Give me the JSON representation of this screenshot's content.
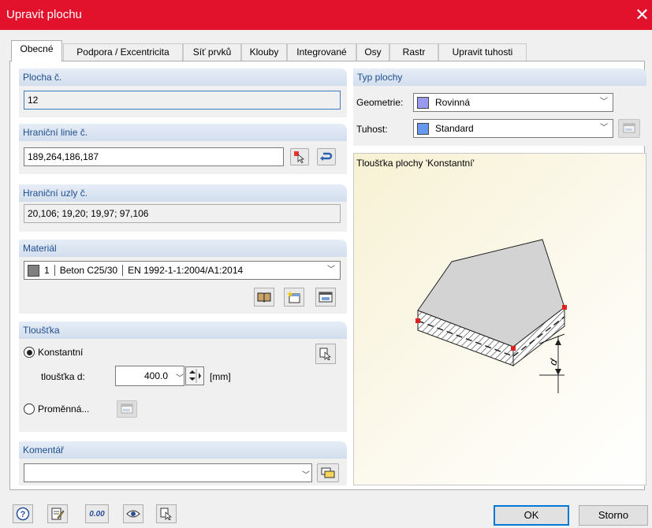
{
  "window": {
    "title": "Upravit plochu",
    "close_glyph": "✕"
  },
  "tabs": [
    {
      "label": "Obecné",
      "active": true
    },
    {
      "label": "Podpora / Excentricita"
    },
    {
      "label": "Síť prvků"
    },
    {
      "label": "Klouby"
    },
    {
      "label": "Integrované"
    },
    {
      "label": "Osy"
    },
    {
      "label": "Rastr"
    },
    {
      "label": "Upravit tuhosti"
    }
  ],
  "surface_no": {
    "header": "Plocha č.",
    "value": "12"
  },
  "boundary_lines": {
    "header": "Hraniční linie č.",
    "value": "189,264,186,187"
  },
  "boundary_nodes": {
    "header": "Hraniční uzly č.",
    "value": "20,106; 19,20; 19,97; 97,106"
  },
  "material": {
    "header": "Materiál",
    "number": "1",
    "name": "Beton C25/30",
    "norm": "EN 1992-1-1:2004/A1:2014",
    "swatch_color": "#808080"
  },
  "thickness": {
    "header": "Tloušťka",
    "constant_label": "Konstantní",
    "d_label": "tloušťka d:",
    "d_value": "400.0",
    "unit": "[mm]",
    "variable_label": "Proměnná..."
  },
  "comment": {
    "header": "Komentář",
    "value": ""
  },
  "surface_type": {
    "header": "Typ plochy",
    "geometry_label": "Geometrie:",
    "geometry_value": "Rovinná",
    "geometry_color": "#9999ee",
    "stiffness_label": "Tuhost:",
    "stiffness_value": "Standard",
    "stiffness_color": "#6699ee"
  },
  "preview": {
    "caption": "Tloušťka plochy 'Konstantní'",
    "dim_label": "d"
  },
  "footer": {
    "ok": "OK",
    "cancel": "Storno",
    "units_icon_text": "0.00"
  }
}
